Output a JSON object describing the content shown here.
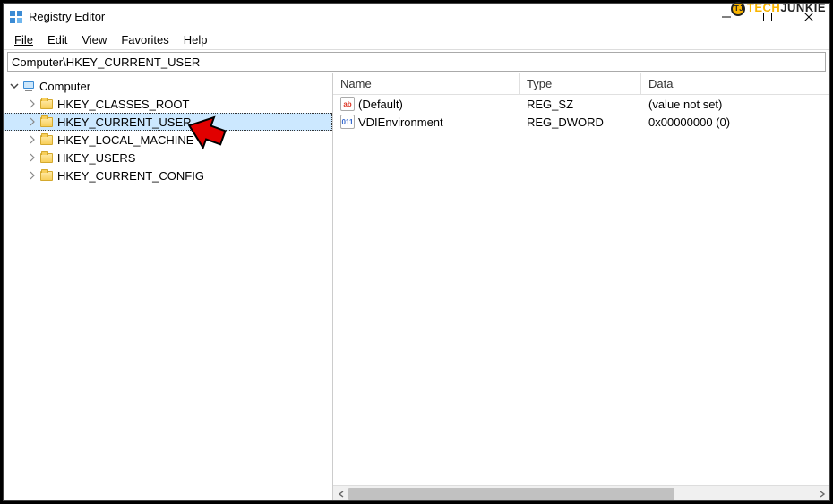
{
  "window": {
    "title": "Registry Editor"
  },
  "watermark": {
    "tech": "TECH",
    "junkie": "JUNKIE"
  },
  "menubar": {
    "items": [
      "File",
      "Edit",
      "View",
      "Favorites",
      "Help"
    ]
  },
  "addressbar": {
    "path": "Computer\\HKEY_CURRENT_USER"
  },
  "tree": {
    "root": "Computer",
    "hives": [
      "HKEY_CLASSES_ROOT",
      "HKEY_CURRENT_USER",
      "HKEY_LOCAL_MACHINE",
      "HKEY_USERS",
      "HKEY_CURRENT_CONFIG"
    ],
    "selected_index": 1
  },
  "list": {
    "columns": {
      "name": "Name",
      "type": "Type",
      "data": "Data"
    },
    "rows": [
      {
        "icon": "string",
        "name": "(Default)",
        "type": "REG_SZ",
        "data": "(value not set)"
      },
      {
        "icon": "binary",
        "name": "VDIEnvironment",
        "type": "REG_DWORD",
        "data": "0x00000000 (0)"
      }
    ]
  }
}
